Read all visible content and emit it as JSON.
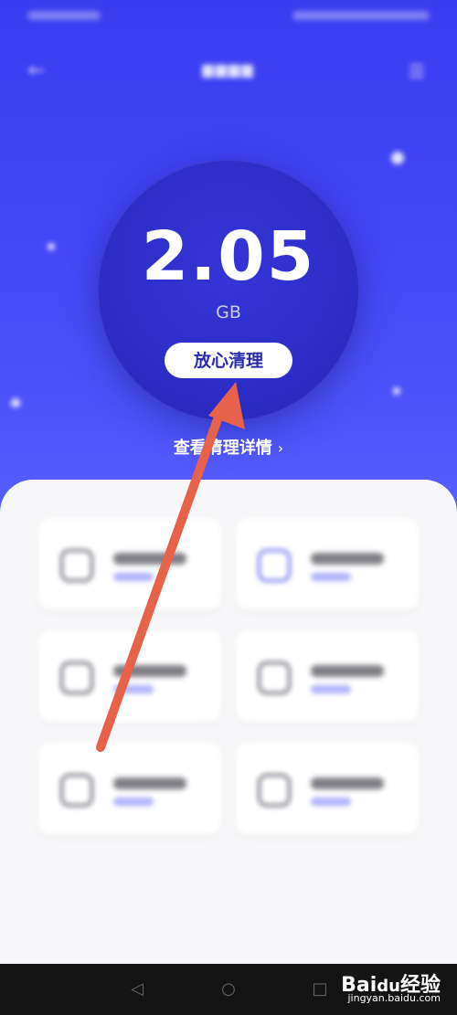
{
  "app": {
    "cleanup": {
      "size_value": "2.05",
      "size_unit": "GB",
      "clean_button_label": "放心清理",
      "details_link_label": "查看清理详情",
      "details_chevron": "›"
    },
    "nav_icons": {
      "back": "back-arrow-icon",
      "menu": "menu-icon"
    }
  },
  "watermark": {
    "main": "Bai",
    "paw": "du",
    "suffix": "经验",
    "sub": "jingyan.baidu.com"
  },
  "colors": {
    "hero_top": "#3a3cf0",
    "hero_bottom": "#5a62ff",
    "circle": "#2b2bc4",
    "button_text": "#2b2bb0",
    "annotation_arrow": "#e8614a"
  }
}
